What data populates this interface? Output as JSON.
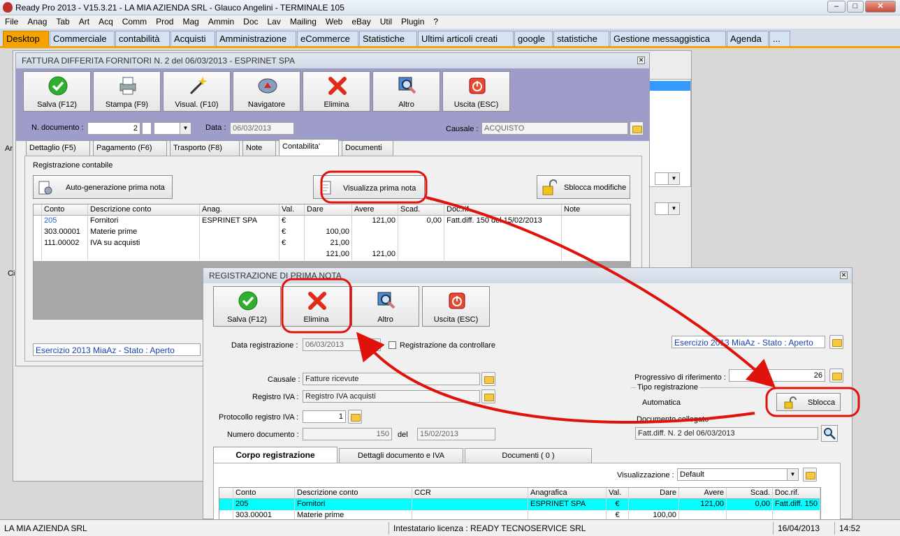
{
  "app": {
    "title": "Ready Pro 2013 - V15.3.21 - LA MIA AZIENDA SRL - Glauco Angelini - TERMINALE 105",
    "minimize": "–",
    "maximize": "□",
    "close": "✕"
  },
  "menu": [
    "File",
    "Anag",
    "Tab",
    "Art",
    "Acq",
    "Comm",
    "Prod",
    "Mag",
    "Ammin",
    "Doc",
    "Lav",
    "Mailing",
    "Web",
    "eBay",
    "Util",
    "Plugin",
    "?"
  ],
  "tabs": [
    "Desktop",
    "Commerciale",
    "contabilità",
    "Acquisti",
    "Amministrazione",
    "eCommerce",
    "Statistiche",
    "Ultimi articoli creati",
    "google",
    "statistiche",
    "Gestione messaggistica",
    "Agenda",
    "..."
  ],
  "bg_fragments": [
    "Ar",
    "Ci"
  ],
  "invoice_window": {
    "title": "FATTURA DIFFERITA FORNITORI N. 2 del 06/03/2013 - ESPRINET SPA",
    "close": "✕",
    "toolbar": [
      "Salva (F12)",
      "Stampa (F9)",
      "Visual. (F10)",
      "Navigatore",
      "Elimina",
      "Altro",
      "Uscita (ESC)"
    ],
    "ndoc_label": "N. documento :",
    "ndoc_value": "2",
    "data_label": "Data :",
    "data_value": "06/03/2013",
    "causale_label": "Causale :",
    "causale_value": "ACQUISTO",
    "tabs": [
      "Dettaglio (F5)",
      "Pagamento (F6)",
      "Trasporto (F8)",
      "Note",
      "Contabilita'",
      "Documenti"
    ],
    "section_title": "Registrazione contabile",
    "auto_btn": "Auto-generazione prima nota",
    "view_btn": "Visualizza prima nota",
    "unlock_btn": "Sblocca modifiche",
    "grid_headers": [
      "Conto",
      "Descrizione conto",
      "Anag.",
      "Val.",
      "Dare",
      "Avere",
      "Scad.",
      "Doc.rif.",
      "Note"
    ],
    "grid_rows": [
      [
        "205",
        "Fornitori",
        "ESPRINET SPA",
        "€",
        "",
        "121,00",
        "0,00",
        "Fatt.diff. 150 del 15/02/2013",
        ""
      ],
      [
        "303.00001",
        "Materie prime",
        "",
        "€",
        "100,00",
        "",
        "",
        "",
        ""
      ],
      [
        "111.00002",
        "IVA su acquisti",
        "",
        "€",
        "21,00",
        "",
        "",
        "",
        ""
      ],
      [
        "",
        "",
        "",
        "",
        "121,00",
        "121,00",
        "",
        "",
        ""
      ]
    ],
    "esercizio": "Esercizio 2013 MiaAz - Stato : Aperto"
  },
  "prima_nota": {
    "title": "REGISTRAZIONE DI PRIMA NOTA",
    "close": "✕",
    "toolbar": [
      "Salva (F12)",
      "Elimina",
      "Altro",
      "Uscita (ESC)"
    ],
    "esercizio": "Esercizio 2013 MiaAz - Stato : Aperto",
    "data_reg_label": "Data registrazione :",
    "data_reg_value": "06/03/2013",
    "check_label": "Registrazione da controllare",
    "causale_label": "Causale :",
    "causale_value": "Fatture ricevute",
    "registro_label": "Registro IVA :",
    "registro_value": "Registro IVA acquisti",
    "protocollo_label": "Protocollo registro IVA :",
    "protocollo_value": "1",
    "numdoc_label": "Numero documento :",
    "numdoc_value": "150",
    "del_label": "del",
    "del_value": "15/02/2013",
    "progressivo_label": "Progressivo di riferimento :",
    "progressivo_value": "26",
    "tipo_label": "Tipo registrazione",
    "tipo_value": "Automatica",
    "sblocca_btn": "Sblocca",
    "doc_collegato_label": "Documento collegato",
    "doc_collegato_value": "Fatt.diff. N. 2 del 06/03/2013",
    "tabs": [
      "Corpo registrazione",
      "Dettagli documento e IVA",
      "Documenti ( 0 )"
    ],
    "visual_label": "Visualizzazione :",
    "visual_value": "Default",
    "grid_headers": [
      "Conto",
      "Descrizione conto",
      "CCR",
      "Anagrafica",
      "Val.",
      "Dare",
      "Avere",
      "Scad.",
      "Doc.rif."
    ],
    "grid_rows": [
      [
        "205",
        "Fornitori",
        "",
        "ESPRINET SPA",
        "€",
        "",
        "121,00",
        "0,00",
        "Fatt.diff. 150"
      ],
      [
        "303.00001",
        "Materie prime",
        "",
        "",
        "€",
        "100,00",
        "",
        "",
        ""
      ]
    ]
  },
  "status": {
    "company": "LA MIA AZIENDA SRL",
    "license": "Intestatario licenza : READY TECNOSERVICE SRL",
    "date": "16/04/2013",
    "time": "14:52"
  },
  "colors": {
    "tab_active": "#f6a200",
    "invoice_header_bg": "#9e9cc9",
    "highlight_row": "#00ffff",
    "annotation_red": "#e0120c",
    "link_blue": "#1a3fb0"
  }
}
